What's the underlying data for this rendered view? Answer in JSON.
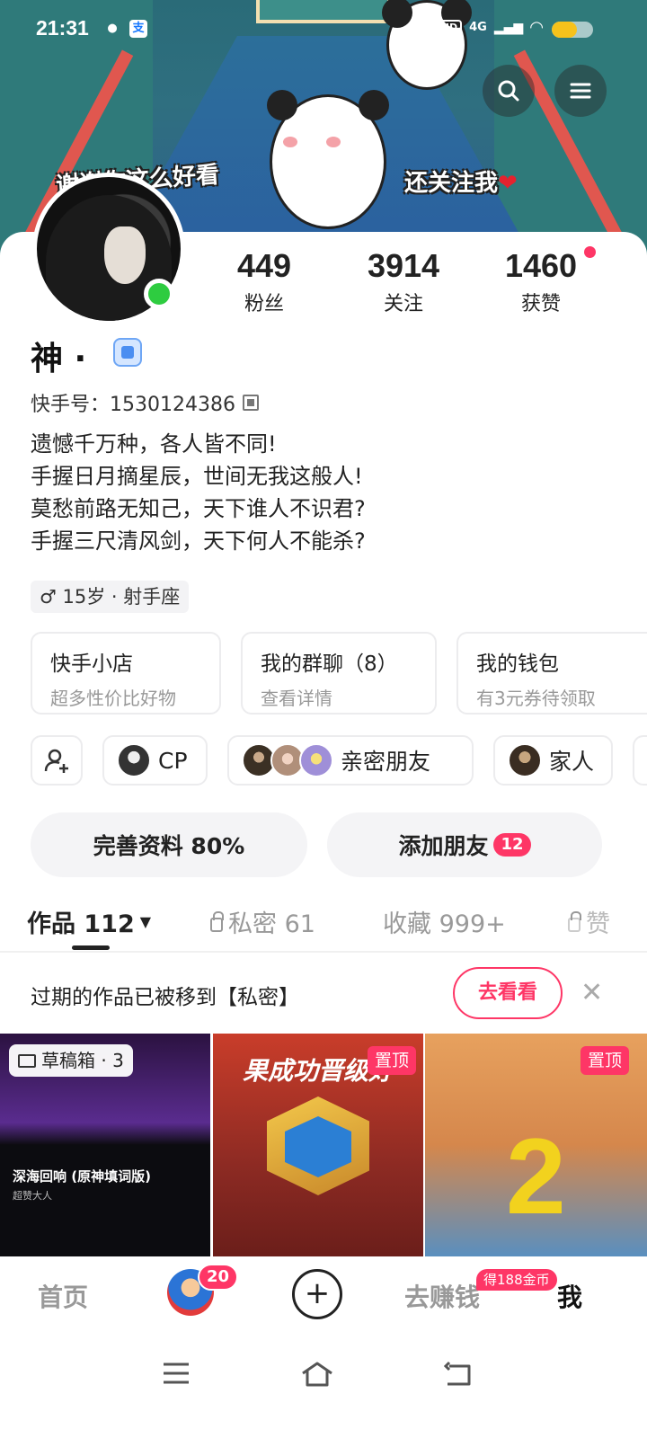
{
  "status_bar": {
    "time": "21:31",
    "network": "4G",
    "hd_label": "HD",
    "battery_fraction": 0.6
  },
  "banner": {
    "caption_left": "谢谢你这么好看",
    "caption_right": "还关注我",
    "heart": "❤"
  },
  "header_actions": {
    "search_icon": "search-icon",
    "menu_icon": "hamburger-menu-icon"
  },
  "stats": [
    {
      "value": "449",
      "label": "粉丝"
    },
    {
      "value": "3914",
      "label": "关注"
    },
    {
      "value": "1460",
      "label": "获赞"
    }
  ],
  "profile": {
    "name": "神 ·",
    "kuaishou_id": "快手号：1530124386",
    "bio": [
      "遗憾千万种，各人皆不同!",
      "手握日月摘星辰，世间无我这般人!",
      "莫愁前路无知己，天下谁人不识君?",
      "手握三尺清风剑，天下何人不能杀?"
    ],
    "tag": "♂ 15岁 · 射手座"
  },
  "services": [
    {
      "title": "快手小店",
      "subtitle": "超多性价比好物"
    },
    {
      "title": "我的群聊（8）",
      "subtitle": "查看详情"
    },
    {
      "title": "我的钱包",
      "subtitle": "有3元券待领取"
    }
  ],
  "relations": {
    "cp_label": "CP",
    "close_friends_label": "亲密朋友",
    "family_label": "家人"
  },
  "actions": {
    "complete_profile": "完善资料 80%",
    "add_friends": "添加朋友",
    "add_friends_badge": "12"
  },
  "tabs": [
    {
      "label": "作品 112",
      "active": true
    },
    {
      "label": "私密 61",
      "locked": true
    },
    {
      "label": "收藏 999+"
    },
    {
      "label": "赞",
      "locked": true
    }
  ],
  "notice": {
    "text": "过期的作品已被移到【私密】",
    "button": "去看看",
    "close": "✕"
  },
  "thumbnails": {
    "draft_label": "草稿箱 · 3",
    "t1_line1": "深海回响 (原神填词版)",
    "t1_line2": "超赞大人",
    "t2_subtitle": "果成功晋级好",
    "pinned_label": "置顶",
    "t3_big": "2"
  },
  "bottom_nav": {
    "home": "首页",
    "avatar_badge": "20",
    "plus": "+",
    "earn": "去赚钱",
    "coin_badge": "得188金币",
    "me": "我"
  },
  "colors": {
    "accent": "#fe3666",
    "online": "#2ecc40"
  }
}
